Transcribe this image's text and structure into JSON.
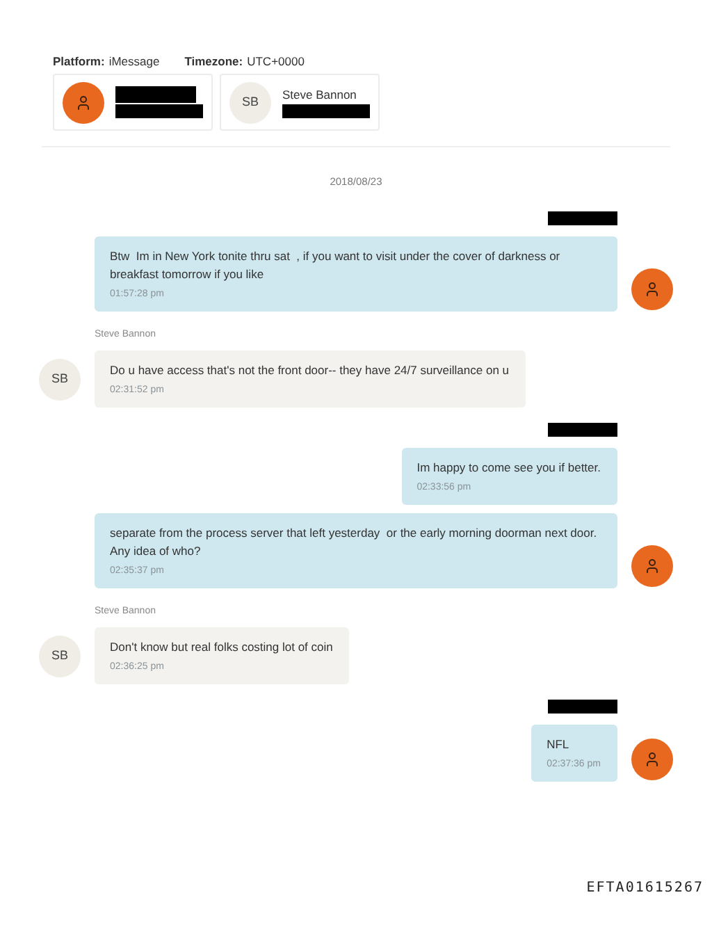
{
  "header": {
    "platform_label": "Platform:",
    "platform": "iMessage",
    "timezone_label": "Timezone:",
    "timezone": "UTC+0000"
  },
  "participants": [
    {
      "kind": "self",
      "name_redacted": true,
      "detail_redacted": true
    },
    {
      "kind": "contact",
      "initials": "SB",
      "name": "Steve Bannon",
      "name_redacted": false,
      "detail_redacted": true
    }
  ],
  "date": "2018/08/23",
  "messages": [
    {
      "kind": "outgoing",
      "sender_redacted": true,
      "text": "Btw  Im in New York tonite thru sat  , if you want to visit under the cover of darkness or breakfast tomorrow if you like",
      "time": "01:57:28 pm",
      "avatar": true
    },
    {
      "kind": "incoming",
      "sender": "Steve Bannon",
      "initials": "SB",
      "text": "Do u have access that's not the front door-- they have 24/7 surveillance on u",
      "time": "02:31:52 pm",
      "avatar": true
    },
    {
      "kind": "outgoing",
      "sender_redacted": true,
      "text": "Im happy to come see you if better.",
      "time": "02:33:56 pm",
      "avatar": false
    },
    {
      "kind": "outgoing",
      "sender_redacted": false,
      "text": "separate from the process server that left yesterday  or the early morning doorman next door.   Any idea of who?",
      "time": "02:35:37 pm",
      "avatar": true
    },
    {
      "kind": "incoming",
      "sender": "Steve Bannon",
      "initials": "SB",
      "text": "Don't know but real folks costing lot of coin",
      "time": "02:36:25 pm",
      "avatar": true
    },
    {
      "kind": "outgoing",
      "sender_redacted": true,
      "text": "NFL",
      "time": "02:37:36 pm",
      "avatar": true
    }
  ],
  "footer": {
    "document_id": "EFTA01615267"
  }
}
